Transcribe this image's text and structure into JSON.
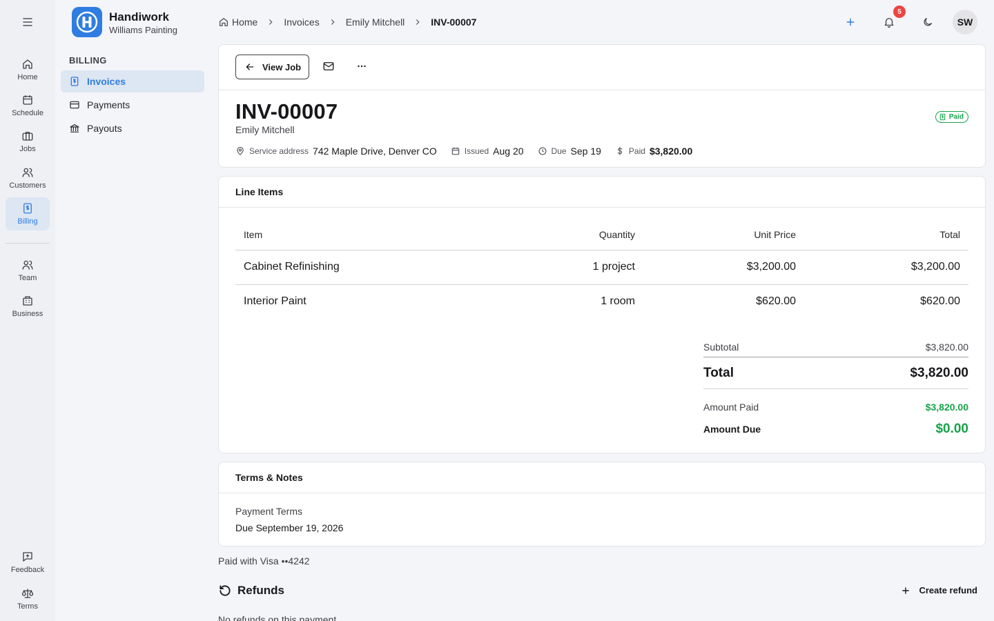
{
  "app": {
    "name": "Handiwork",
    "company": "Williams Painting"
  },
  "rail": {
    "items": [
      {
        "label": "Home",
        "icon": "home-icon"
      },
      {
        "label": "Schedule",
        "icon": "calendar-icon"
      },
      {
        "label": "Jobs",
        "icon": "briefcase-icon"
      },
      {
        "label": "Customers",
        "icon": "users-icon"
      },
      {
        "label": "Billing",
        "icon": "dollar-receipt-icon",
        "active": true
      },
      {
        "label": "Team",
        "icon": "team-icon"
      },
      {
        "label": "Business",
        "icon": "building-icon"
      },
      {
        "label": "Feedback",
        "icon": "feedback-icon"
      },
      {
        "label": "Terms",
        "icon": "scale-icon"
      }
    ]
  },
  "sidebar": {
    "title": "BILLING",
    "items": [
      {
        "label": "Invoices",
        "icon": "dollar-receipt-icon",
        "active": true
      },
      {
        "label": "Payments",
        "icon": "credit-card-icon"
      },
      {
        "label": "Payouts",
        "icon": "bank-icon"
      }
    ]
  },
  "breadcrumb": [
    "Home",
    "Invoices",
    "Emily Mitchell",
    "INV-00007"
  ],
  "topbar": {
    "notifications": "5",
    "avatar": "SW"
  },
  "toolbar": {
    "view_job": "View Job"
  },
  "invoice": {
    "number": "INV-00007",
    "customer": "Emily Mitchell",
    "status": "Paid",
    "meta": {
      "service_label": "Service address",
      "service_value": "742 Maple Drive, Denver CO",
      "issued_label": "Issued",
      "issued_value": "Aug 20",
      "due_label": "Due",
      "due_value": "Sep 19",
      "paid_label": "Paid",
      "paid_value": "$3,820.00"
    }
  },
  "line_items": {
    "title": "Line Items",
    "columns": [
      "Item",
      "Quantity",
      "Unit Price",
      "Total"
    ],
    "rows": [
      {
        "item": "Cabinet Refinishing",
        "quantity": "1 project",
        "unit_price": "$3,200.00",
        "total": "$3,200.00"
      },
      {
        "item": "Interior Paint",
        "quantity": "1 room",
        "unit_price": "$620.00",
        "total": "$620.00"
      }
    ]
  },
  "totals": {
    "subtotal_label": "Subtotal",
    "subtotal": "$3,820.00",
    "total_label": "Total",
    "total": "$3,820.00",
    "amount_paid_label": "Amount Paid",
    "amount_paid": "$3,820.00",
    "amount_due_label": "Amount Due",
    "amount_due": "$0.00"
  },
  "terms": {
    "title": "Terms & Notes",
    "label": "Payment Terms",
    "value": "Due September 19, 2026"
  },
  "payment": {
    "paid_with": "Paid with Visa ••4242"
  },
  "refunds": {
    "title": "Refunds",
    "create": "Create refund",
    "empty": "No refunds on this payment"
  },
  "colors": {
    "accent": "#2f7de1",
    "success": "#16a34a",
    "badge": "#ef4444"
  }
}
